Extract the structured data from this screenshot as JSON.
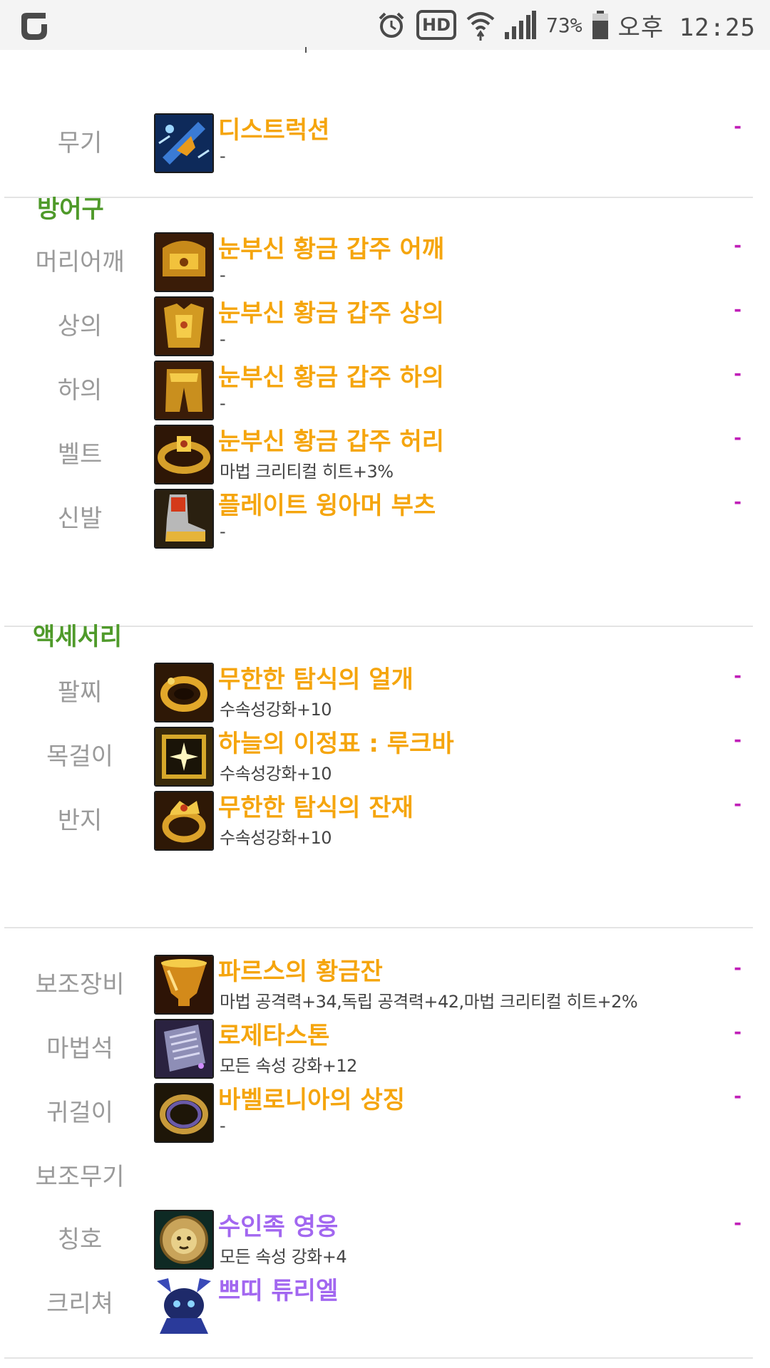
{
  "status_bar": {
    "battery_percent": "73%",
    "time": "오후 12:25",
    "hd_label": "HD",
    "colors": {
      "background": "#f4f4f4",
      "icon": "#4a4a4a"
    }
  },
  "colors": {
    "section_header": "#4f9a2a",
    "slot_label": "#9a9a9a",
    "item_name_orange": "#f5a50d",
    "item_name_purple": "#a267f0",
    "dash": "#c01fb8"
  },
  "weapon": {
    "label": "무기",
    "name": "디스트럭션",
    "option": "-",
    "dash": "-",
    "icon": "weapon-icon"
  },
  "armor": {
    "header": "방어구",
    "items": [
      {
        "label": "머리어깨",
        "name": "눈부신 황금 갑주 어깨",
        "option": "-",
        "dash": "-",
        "icon": "shoulder-icon"
      },
      {
        "label": "상의",
        "name": "눈부신 황금 갑주 상의",
        "option": "-",
        "dash": "-",
        "icon": "top-icon"
      },
      {
        "label": "하의",
        "name": "눈부신 황금 갑주 하의",
        "option": "-",
        "dash": "-",
        "icon": "bottom-icon"
      },
      {
        "label": "벨트",
        "name": "눈부신 황금 갑주 허리",
        "option": "마법 크리티컬 히트+3%",
        "dash": "-",
        "icon": "belt-icon"
      },
      {
        "label": "신발",
        "name": "플레이트 윙아머 부츠",
        "option": "-",
        "dash": "-",
        "icon": "boots-icon"
      }
    ]
  },
  "accessory": {
    "header": "액세서리",
    "items": [
      {
        "label": "팔찌",
        "name": "무한한 탐식의 얼개",
        "option": "수속성강화+10",
        "dash": "-",
        "icon": "bracelet-icon"
      },
      {
        "label": "목걸이",
        "name": "하늘의 이정표 : 루크바",
        "option": "수속성강화+10",
        "dash": "-",
        "icon": "necklace-icon"
      },
      {
        "label": "반지",
        "name": "무한한 탐식의 잔재",
        "option": "수속성강화+10",
        "dash": "-",
        "icon": "ring-icon"
      }
    ]
  },
  "special": {
    "items": [
      {
        "label": "보조장비",
        "name": "파르스의 황금잔",
        "option": "마법 공격력+34,독립 공격력+42,마법 크리티컬 히트+2%",
        "dash": "-",
        "icon": "cup-icon"
      },
      {
        "label": "마법석",
        "name": "로제타스톤",
        "option": "모든 속성 강화+12",
        "dash": "-",
        "icon": "magic-stone-icon"
      },
      {
        "label": "귀걸이",
        "name": "바벨로니아의 상징",
        "option": "-",
        "dash": "-",
        "icon": "earring-icon"
      }
    ],
    "sub_weapon_label": "보조무기",
    "title": {
      "label": "칭호",
      "name": "수인족 영웅",
      "option": "모든 속성 강화+4",
      "dash": "-",
      "icon": "lion-emblem-icon"
    },
    "creature": {
      "label": "크리쳐",
      "name": "쁘띠 튜리엘",
      "icon": "creature-icon"
    }
  }
}
